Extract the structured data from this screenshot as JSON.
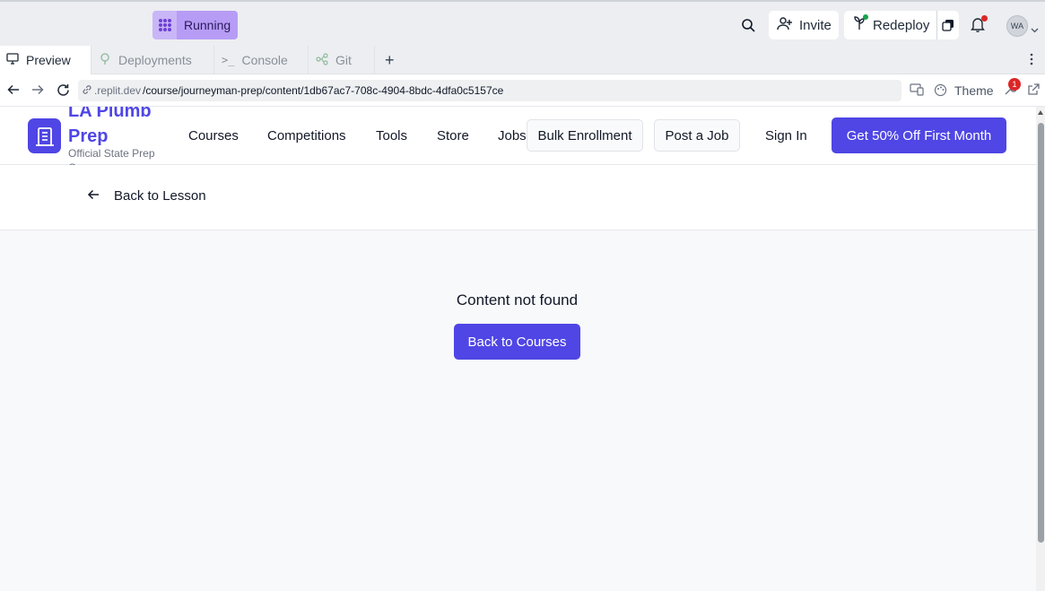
{
  "topbar": {
    "status_label": "Running",
    "invite_label": "Invite",
    "redeploy_label": "Redeploy",
    "avatar_initials": "WA"
  },
  "tabs": [
    {
      "label": "Preview",
      "icon": "monitor-icon",
      "active": true
    },
    {
      "label": "Deployments",
      "icon": "deploy-icon",
      "active": false
    },
    {
      "label": "Console",
      "icon": "terminal-icon",
      "active": false
    },
    {
      "label": "Git",
      "icon": "git-icon",
      "active": false
    }
  ],
  "urlbar": {
    "host": ".replit.dev",
    "path": "/course/journeyman-prep/content/1db67ac7-708c-4904-8bdc-4dfa0c5157ce",
    "theme_label": "Theme",
    "badge_count": "1"
  },
  "site": {
    "brand_name": "LA Plumb Prep",
    "brand_sub": "Official State Prep Course",
    "nav": [
      "Courses",
      "Competitions",
      "Tools",
      "Store",
      "Jobs"
    ],
    "bulk_label": "Bulk Enrollment",
    "post_job_label": "Post a Job",
    "signin_label": "Sign In",
    "cta_label": "Get 50% Off First Month",
    "accent": "#4f46e5"
  },
  "page": {
    "back_label": "Back to Lesson",
    "not_found": "Content not found",
    "back_courses_label": "Back to Courses"
  }
}
